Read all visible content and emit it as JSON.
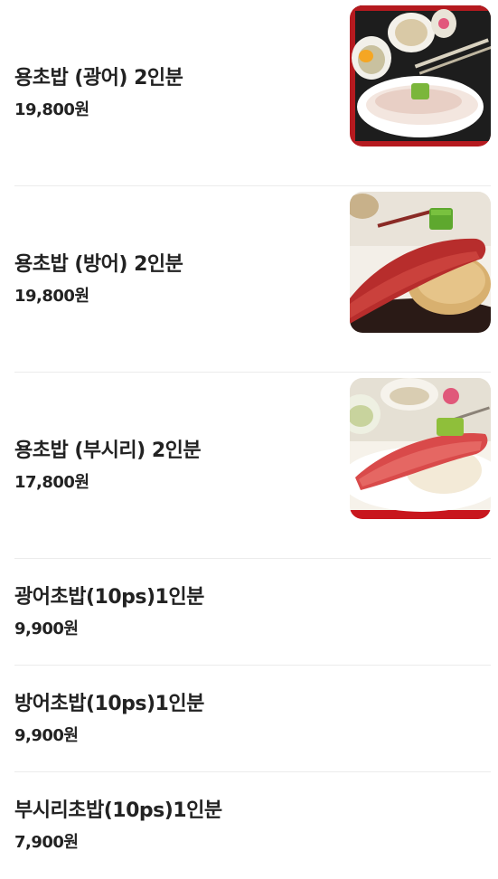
{
  "menu": {
    "items": [
      {
        "name": "용초밥 (광어) 2인분",
        "price": "19,800원",
        "has_photo": true,
        "photo_icon": "halibut-sushi-photo"
      },
      {
        "name": "용초밥 (방어) 2인분",
        "price": "19,800원",
        "has_photo": true,
        "photo_icon": "yellowtail-sushi-photo"
      },
      {
        "name": "용초밥 (부시리) 2인분",
        "price": "17,800원",
        "has_photo": true,
        "photo_icon": "amberjack-sushi-photo"
      },
      {
        "name": "광어초밥(10ps)1인분",
        "price": "9,900원",
        "has_photo": false
      },
      {
        "name": "방어초밥(10ps)1인분",
        "price": "9,900원",
        "has_photo": false
      },
      {
        "name": "부시리초밥(10ps)1인분",
        "price": "7,900원",
        "has_photo": false
      }
    ]
  },
  "colors": {
    "text": "#222222",
    "divider": "#ececec",
    "tray_red": "#c8161d"
  }
}
